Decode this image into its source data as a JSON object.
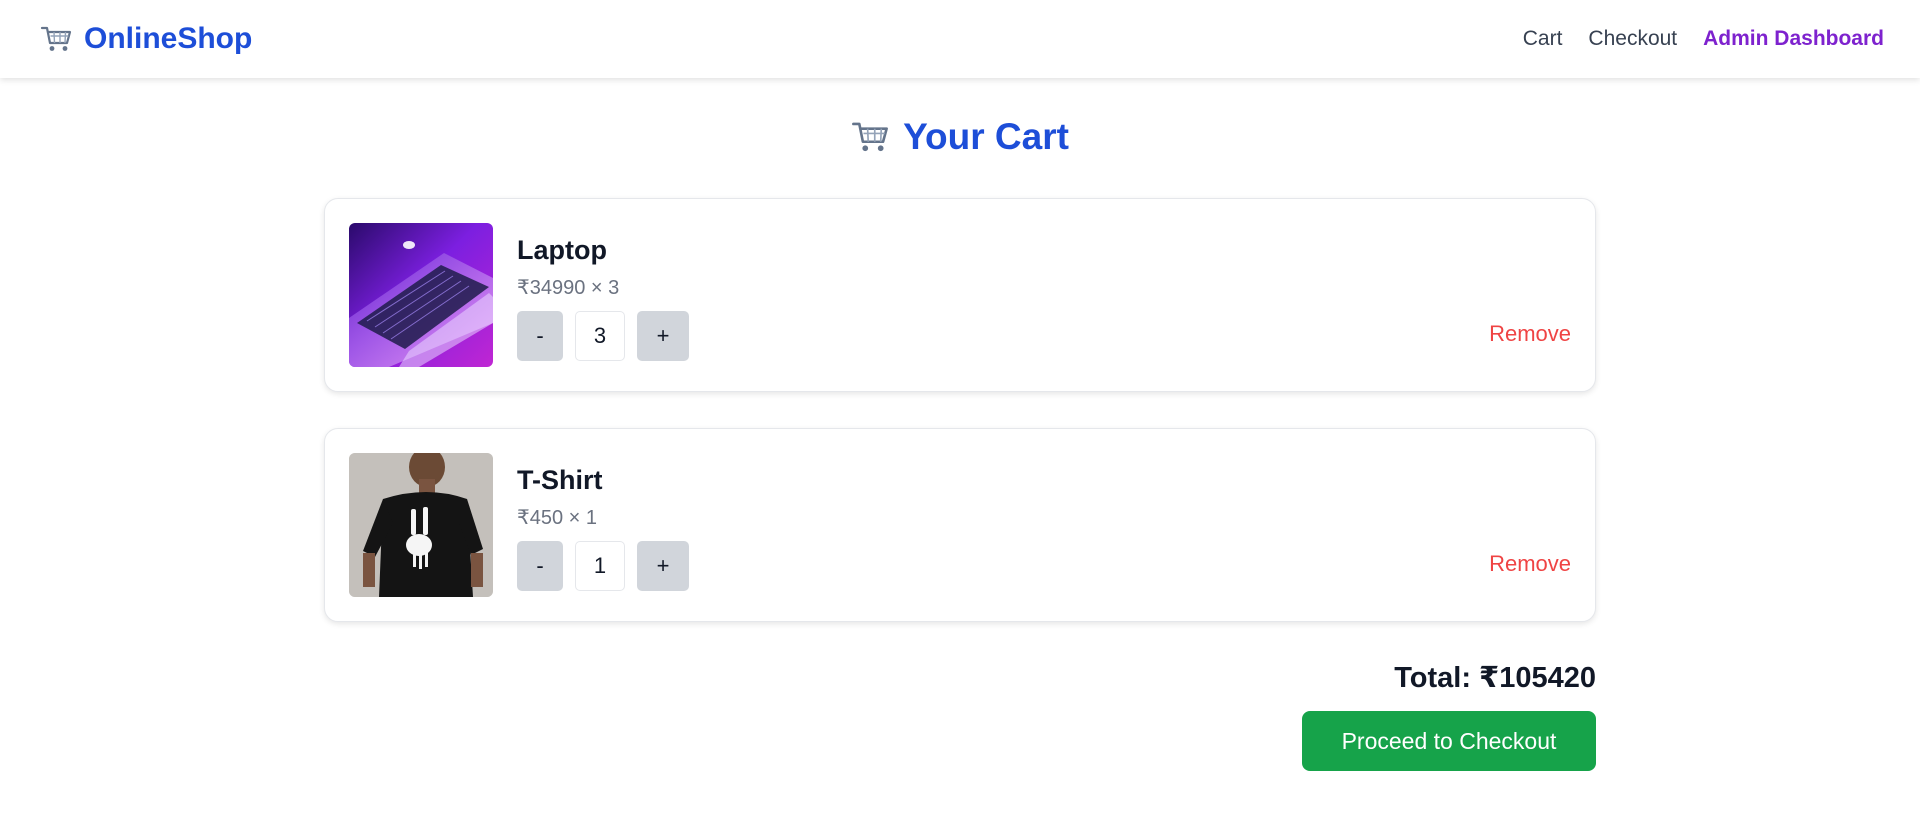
{
  "brand": {
    "name": "OnlineShop",
    "icon": "shopping-cart-icon"
  },
  "nav": {
    "links": [
      {
        "label": "Cart"
      },
      {
        "label": "Checkout"
      },
      {
        "label": "Admin Dashboard"
      }
    ]
  },
  "page": {
    "title": "Your Cart",
    "title_icon": "shopping-cart-icon"
  },
  "cart": {
    "items": [
      {
        "name": "Laptop",
        "price_line": "₹34990 × 3",
        "quantity": "3",
        "decrement_label": "-",
        "increment_label": "+",
        "remove_label": "Remove",
        "image": "laptop-photo"
      },
      {
        "name": "T-Shirt",
        "price_line": "₹450 × 1",
        "quantity": "1",
        "decrement_label": "-",
        "increment_label": "+",
        "remove_label": "Remove",
        "image": "tshirt-photo"
      }
    ],
    "total_label": "Total: ₹105420",
    "checkout_label": "Proceed to Checkout"
  },
  "colors": {
    "brand_blue": "#1d4ed8",
    "admin_purple": "#7e22ce",
    "remove_red": "#ef4444",
    "checkout_green": "#16a34a"
  }
}
